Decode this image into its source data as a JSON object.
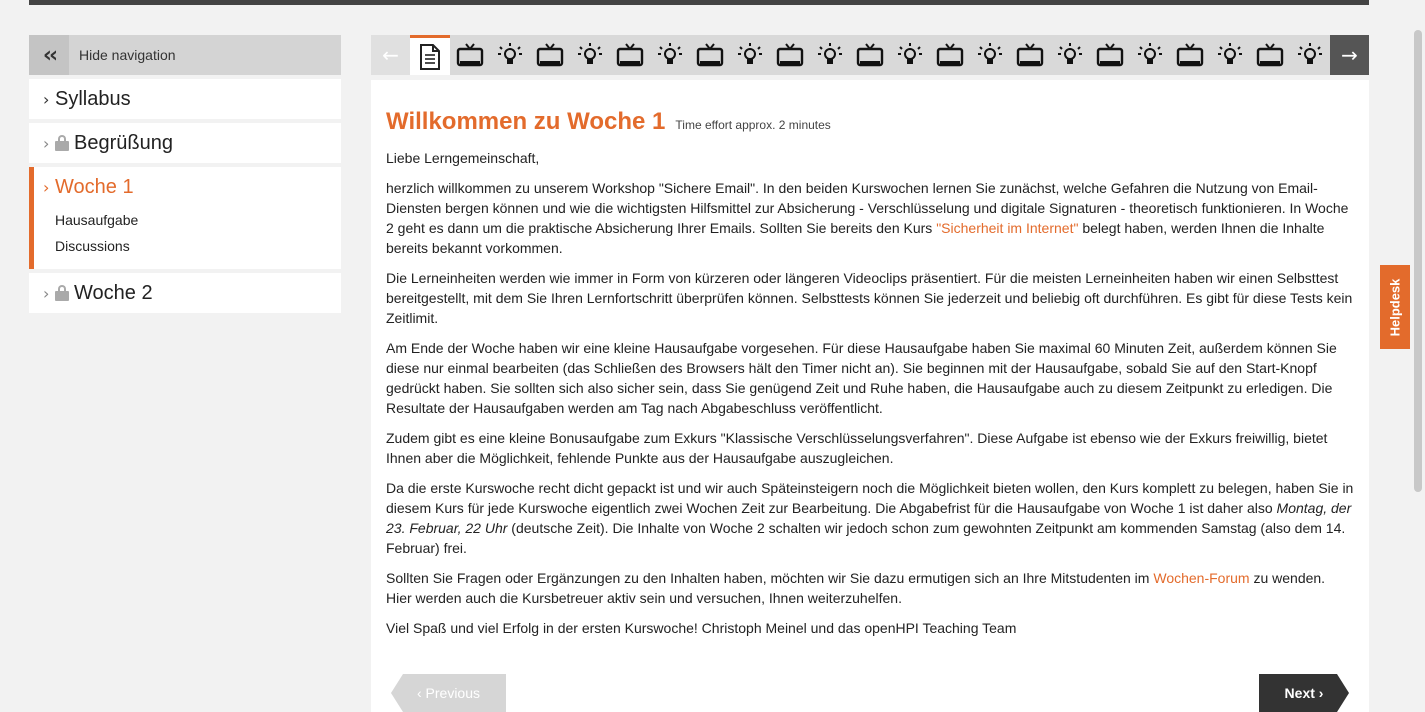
{
  "sidebar": {
    "hide_nav_label": "Hide navigation",
    "items": [
      {
        "title": "Syllabus",
        "locked": false
      },
      {
        "title": "Begrüßung",
        "locked": true
      },
      {
        "title": "Woche 1",
        "locked": false,
        "active": true,
        "subitems": [
          "Hausaufgabe",
          "Discussions"
        ]
      },
      {
        "title": "Woche 2",
        "locked": true
      }
    ]
  },
  "item_nav": {
    "items": [
      "document-icon",
      "video-icon",
      "lightbulb-icon",
      "video-icon",
      "lightbulb-icon",
      "video-icon",
      "lightbulb-icon",
      "video-icon",
      "lightbulb-icon",
      "video-icon",
      "lightbulb-icon",
      "video-icon",
      "lightbulb-icon",
      "video-icon",
      "lightbulb-icon",
      "video-icon",
      "lightbulb-icon",
      "video-icon",
      "lightbulb-icon",
      "video-icon",
      "lightbulb-icon",
      "video-icon",
      "lightbulb-icon"
    ],
    "current_index": 0
  },
  "content": {
    "title": "Willkommen zu Woche 1",
    "effort": "Time effort approx. 2 minutes",
    "greeting": "Liebe Lerngemeinschaft,",
    "p1_a": "herzlich willkommen zu unserem Workshop \"Sichere Email\". In den beiden Kurswochen lernen Sie zunächst, welche Gefahren die Nutzung von Email-Diensten bergen können und wie die wichtigsten Hilfsmittel zur Absicherung - Verschlüsselung und digitale Signaturen - theoretisch funktionieren. In Woche 2 geht es dann um die praktische Absicherung Ihrer Emails. Sollten Sie bereits den Kurs ",
    "p1_link": "\"Sicherheit im Internet\"",
    "p1_b": " belegt haben, werden Ihnen die Inhalte bereits bekannt vorkommen.",
    "p2": "Die Lerneinheiten werden wie immer in Form von kürzeren oder längeren Videoclips präsentiert. Für die meisten Lerneinheiten haben wir einen Selbsttest bereitgestellt, mit dem Sie Ihren Lernfortschritt überprüfen können. Selbsttests können Sie jederzeit und beliebig oft durchführen. Es gibt für diese Tests kein Zeitlimit.",
    "p3": "Am Ende der Woche haben wir eine kleine Hausaufgabe vorgesehen. Für diese Hausaufgabe haben Sie maximal 60 Minuten Zeit, außerdem können Sie diese nur einmal bearbeiten (das Schließen des Browsers hält den Timer nicht an). Sie beginnen mit der Hausaufgabe, sobald Sie auf den Start-Knopf gedrückt haben. Sie sollten sich also sicher sein, dass Sie genügend Zeit und Ruhe haben, die Hausaufgabe auch zu diesem Zeitpunkt zu erledigen. Die Resultate der Hausaufgaben werden am Tag nach Abgabeschluss veröffentlicht.",
    "p4": "Zudem gibt es eine kleine Bonusaufgabe zum Exkurs \"Klassische Verschlüsselungsverfahren\". Diese Aufgabe ist ebenso wie der Exkurs freiwillig, bietet Ihnen aber die Möglichkeit, fehlende Punkte aus der Hausaufgabe auszugleichen.",
    "p5_a": "Da die erste Kurswoche recht dicht gepackt ist und wir auch Späteinsteigern noch die Möglichkeit bieten wollen, den Kurs komplett zu belegen, haben Sie in diesem Kurs für jede Kurswoche eigentlich zwei Wochen Zeit zur Bearbeitung. Die Abgabefrist für die Hausaufgabe von Woche 1 ist daher also ",
    "p5_em": "Montag, der 23. Februar, 22 Uhr",
    "p5_b": " (deutsche Zeit). Die Inhalte von Woche 2 schalten wir jedoch schon zum gewohnten Zeitpunkt am kommenden Samstag (also dem 14. Februar) frei.",
    "p6_a": "Sollten Sie Fragen oder Ergänzungen zu den Inhalten haben, möchten wir Sie dazu ermutigen sich an Ihre Mitstudenten im ",
    "p6_link": "Wochen-Forum",
    "p6_b": " zu wenden. Hier werden auch die Kursbetreuer aktiv sein und versuchen, Ihnen weiterzuhelfen.",
    "p7": "Viel Spaß und viel Erfolg in der ersten Kurswoche! Christoph Meinel und das openHPI Teaching Team",
    "prev_label": "‹ Previous",
    "next_label": "Next ›"
  },
  "helpdesk_label": "Helpdesk",
  "colors": {
    "accent": "#e36b2c",
    "dark": "#333333"
  }
}
